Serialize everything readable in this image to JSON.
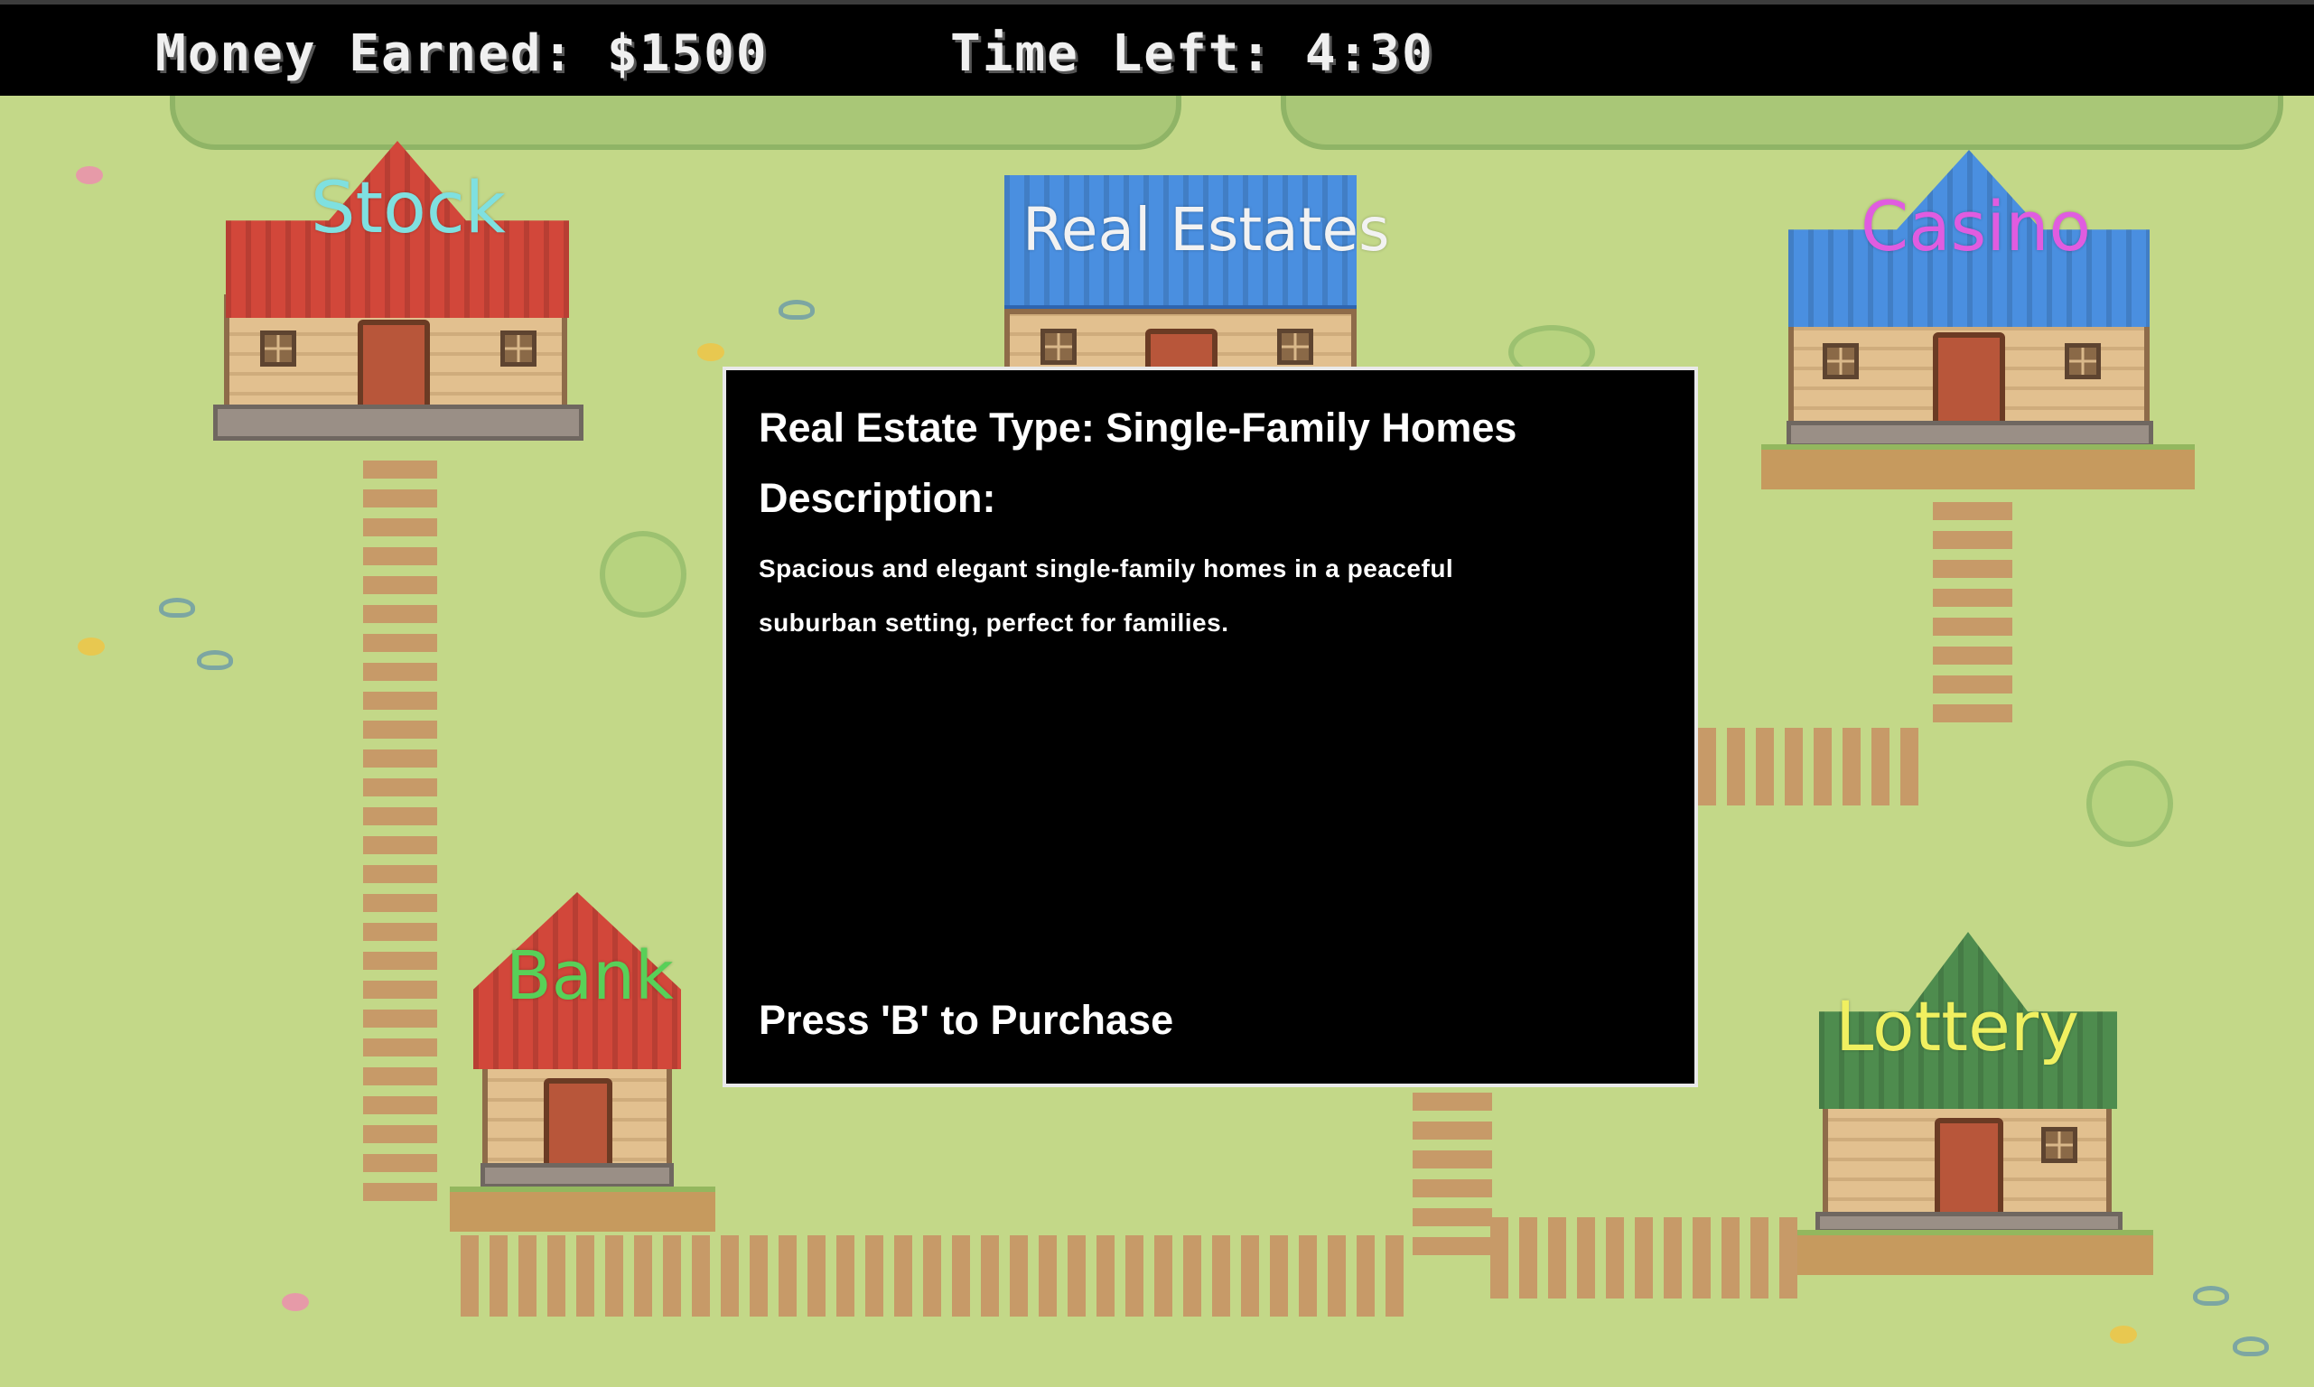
{
  "hud": {
    "money": "Money Earned: $1500",
    "time": "Time Left: 4:30"
  },
  "buildings": {
    "stock": {
      "label": "Stock",
      "label_color": "#7fe0e0"
    },
    "real_estates": {
      "label": "Real Estates",
      "label_color": "#f2f2f2"
    },
    "casino": {
      "label": "Casino",
      "label_color": "#e05ce0"
    },
    "bank": {
      "label": "Bank",
      "label_color": "#58d058"
    },
    "lottery": {
      "label": "Lottery",
      "label_color": "#f0f060"
    }
  },
  "dialog": {
    "type_line": "Real Estate Type: Single-Family Homes",
    "description_label": "Description:",
    "description": "Spacious and elegant single-family homes in a peaceful suburban setting, perfect for families.",
    "action": "Press 'B' to Purchase"
  }
}
